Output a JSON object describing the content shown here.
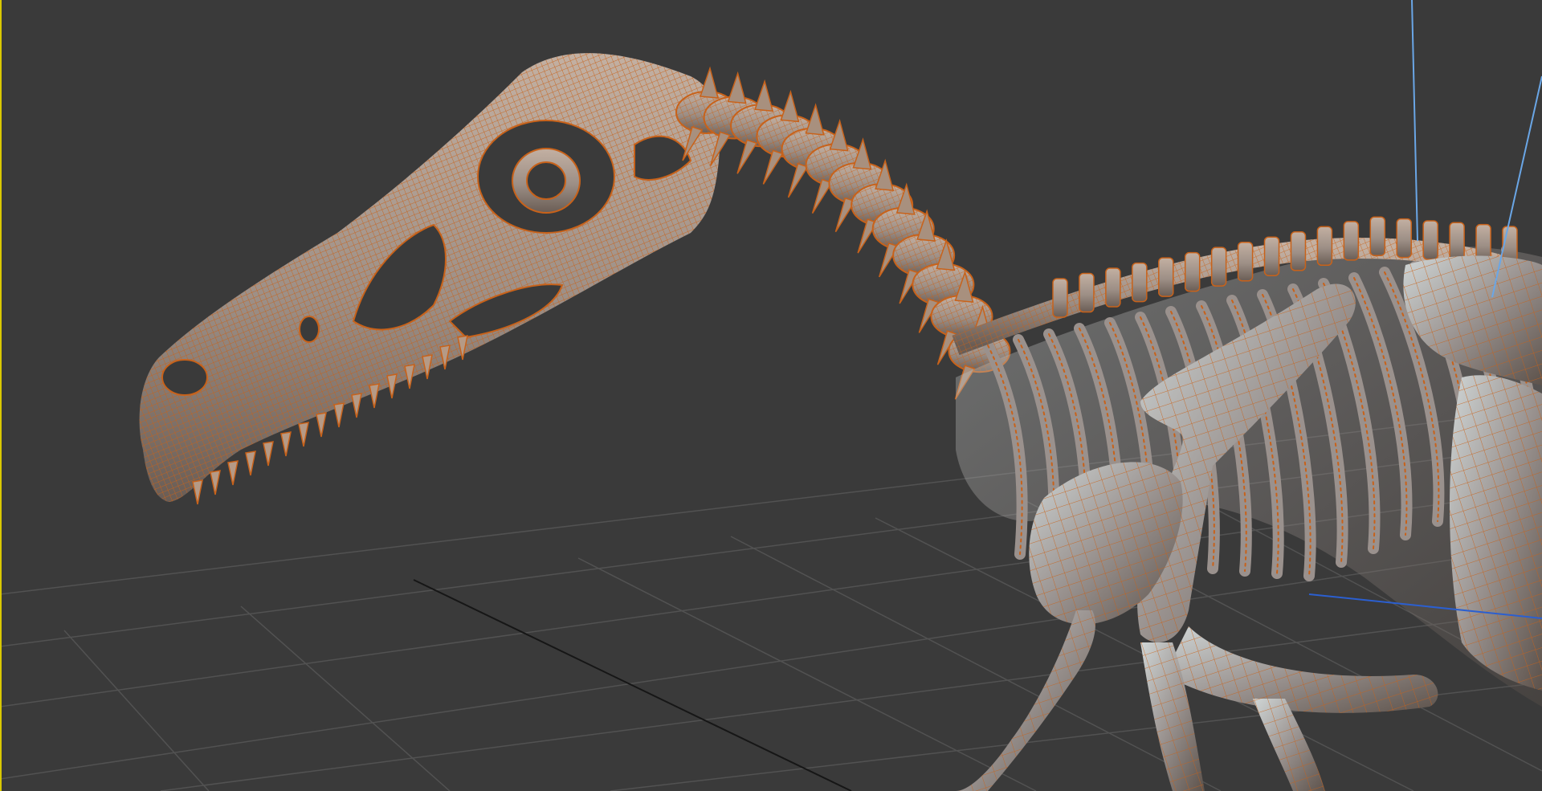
{
  "viewport": {
    "background_color": "#3a3a3a",
    "active_border_color": "#d9c800",
    "grid_color": "#525252",
    "grid_axis_color": "#161616",
    "gizmo_z_axis_color": "#6aa6e6",
    "gizmo_x_axis_color": "#2b5fd0",
    "selected_wireframe_color": "#c8621a",
    "shaded_surface_color": "#a39890",
    "surface_highlight_color": "#c9d3d6",
    "surface_shadow_color": "#5b5048"
  },
  "scene": {
    "model_name_icon": "dinosaur-skeleton-model",
    "view_mode": "shaded-with-wireframe",
    "selection_state": "selected"
  }
}
